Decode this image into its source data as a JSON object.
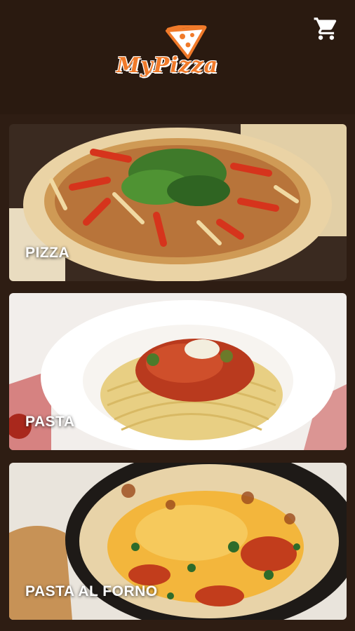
{
  "app": {
    "logo_text": "MyPizza",
    "brand_color": "#f07a2a",
    "header_bg": "#2a1a10",
    "page_bg": "#2e1d13"
  },
  "header": {
    "cart_icon": "shopping-cart-icon"
  },
  "categories": [
    {
      "label": "PIZZA",
      "image": "pizza-photo"
    },
    {
      "label": "PASTA",
      "image": "pasta-photo"
    },
    {
      "label": "PASTA AL FORNO",
      "image": "baked-pasta-photo"
    }
  ]
}
